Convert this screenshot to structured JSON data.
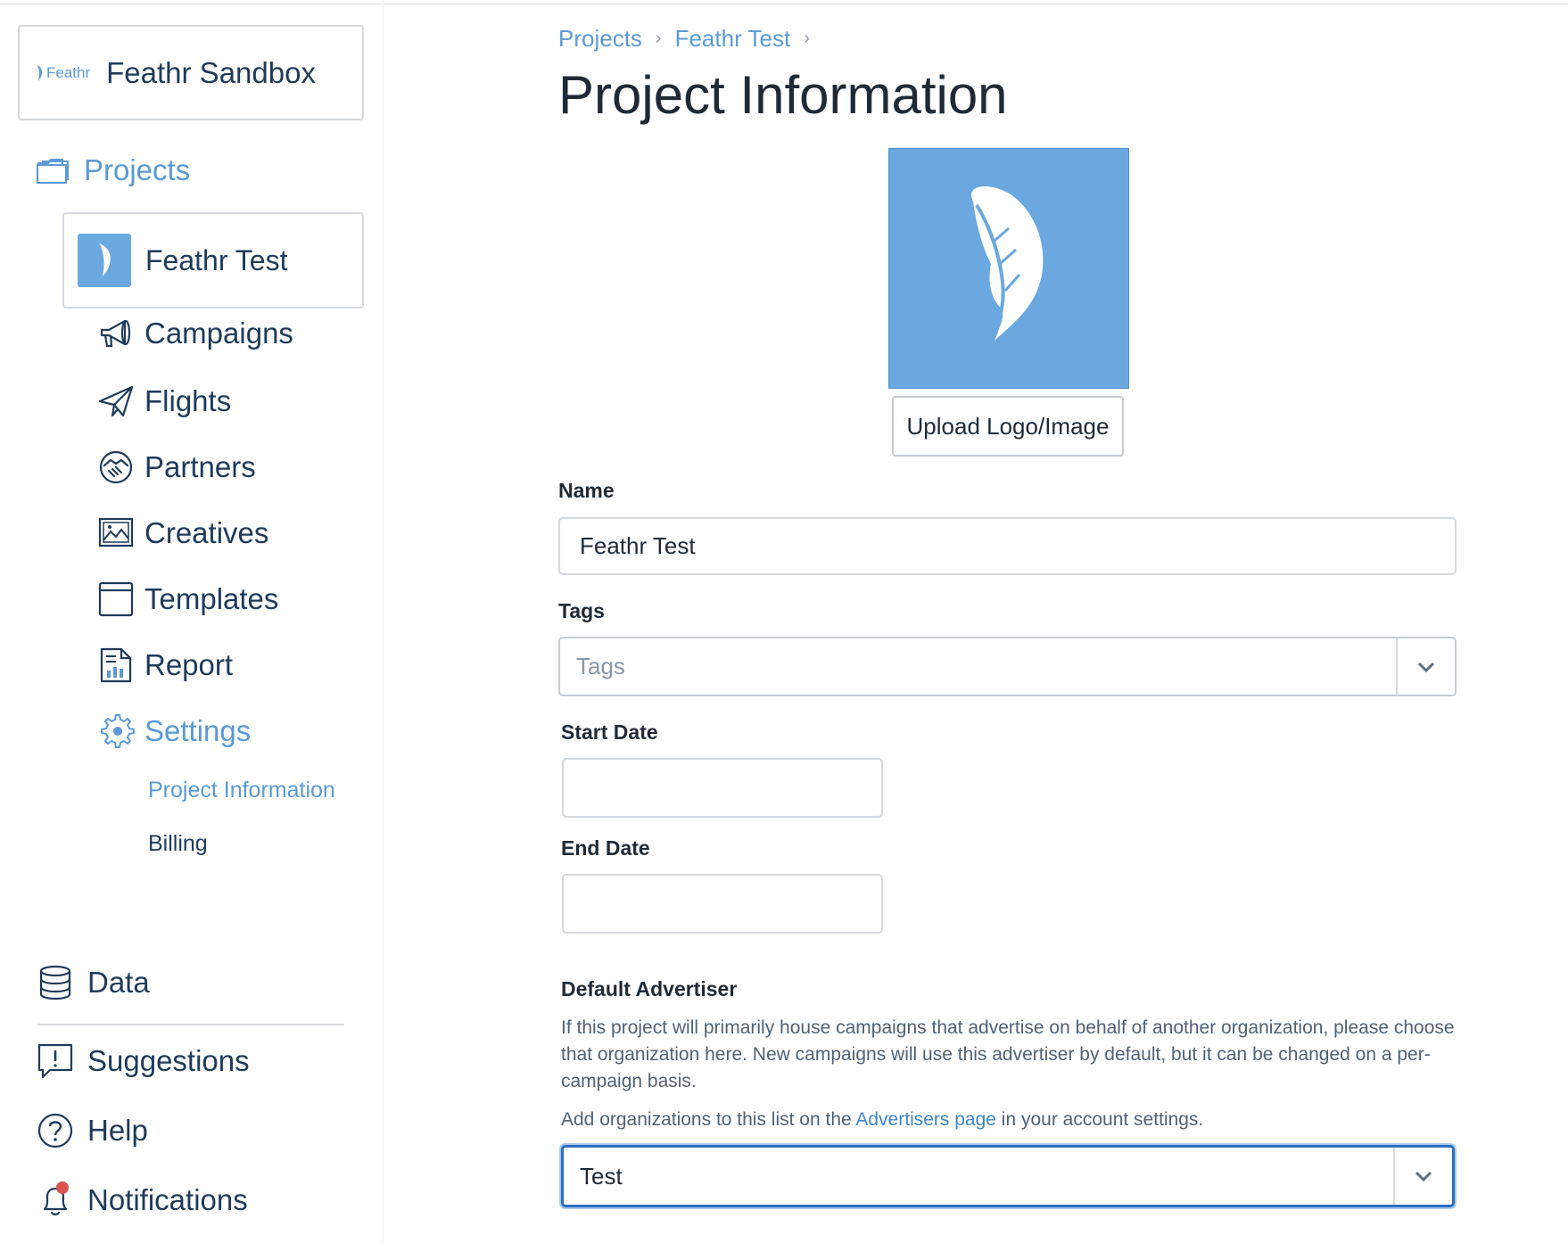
{
  "sidebar": {
    "org_logo_text": "Feathr",
    "org_name": "Feathr Sandbox",
    "projects_label": "Projects",
    "current_project": "Feathr Test",
    "items": [
      {
        "label": "Campaigns",
        "icon": "megaphone-icon"
      },
      {
        "label": "Flights",
        "icon": "paper-plane-icon"
      },
      {
        "label": "Partners",
        "icon": "handshake-icon"
      },
      {
        "label": "Creatives",
        "icon": "image-icon"
      },
      {
        "label": "Templates",
        "icon": "browser-window-icon"
      },
      {
        "label": "Report",
        "icon": "report-chart-icon"
      },
      {
        "label": "Settings",
        "icon": "gear-icon",
        "active": true
      }
    ],
    "settings_subitems": [
      {
        "label": "Project Information",
        "active": true
      },
      {
        "label": "Billing"
      }
    ],
    "bottom": {
      "data": "Data",
      "suggestions": "Suggestions",
      "help": "Help",
      "notifications": "Notifications"
    }
  },
  "breadcrumb": [
    "Projects",
    "Feathr Test"
  ],
  "page_title": "Project Information",
  "upload_button": "Upload Logo/Image",
  "form": {
    "name_label": "Name",
    "name_value": "Feathr Test",
    "tags_label": "Tags",
    "tags_placeholder": "Tags",
    "start_date_label": "Start Date",
    "start_date_value": "",
    "end_date_label": "End Date",
    "end_date_value": "",
    "default_advertiser_label": "Default Advertiser",
    "default_advertiser_help": "If this project will primarily house campaigns that advertise on behalf of another organization, please choose that organization here. New campaigns will use this advertiser by default, but it can be changed on a per-campaign basis.",
    "advertiser_note_before": "Add organizations to this list on the ",
    "advertiser_note_link": "Advertisers page",
    "advertiser_note_after": " in your account settings.",
    "advertiser_selected": "Test"
  },
  "colors": {
    "accent": "#5a9ad6",
    "logo_bg": "#6aa8df",
    "focus_border": "#2c6fc2",
    "notification_dot": "#d9534f"
  }
}
